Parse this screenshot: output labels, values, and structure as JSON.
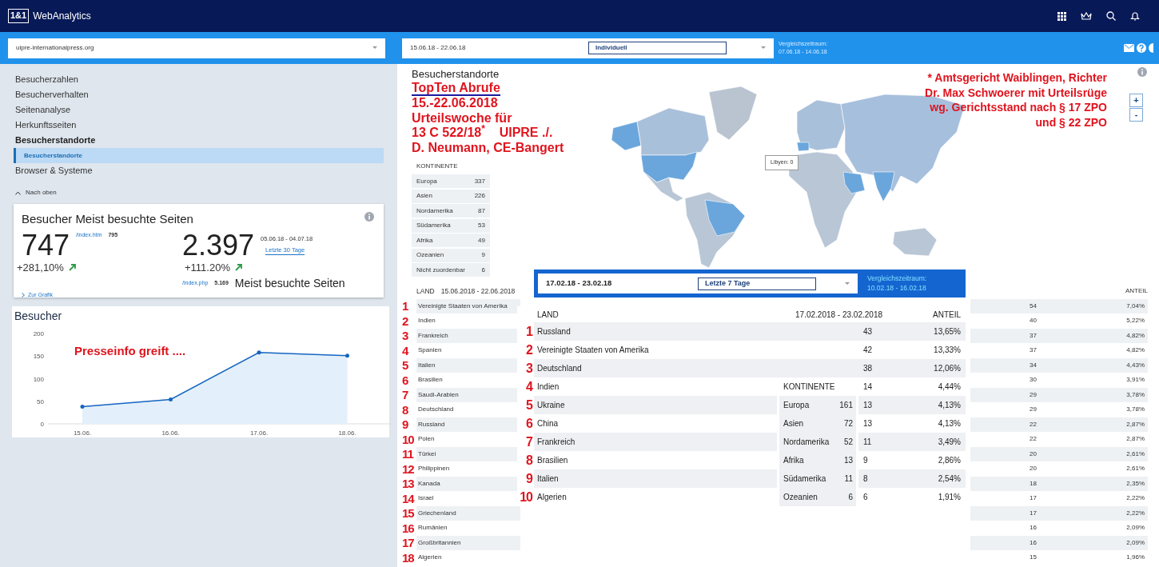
{
  "app": {
    "logo": "1&1",
    "title": "WebAnalytics"
  },
  "site_select": {
    "value": "uipre-internationalpress.org"
  },
  "date_range": {
    "value": "15.06.18 - 22.06.18",
    "preset": "Individuell",
    "comparison_label": "Vergleichszeitraum:",
    "comparison_range": "07.06.18 - 14.06.18"
  },
  "sidebar": {
    "items": [
      {
        "label": "Besucherzahlen",
        "expanded": false,
        "selected": false
      },
      {
        "label": "Besucherverhalten",
        "expanded": false,
        "selected": false
      },
      {
        "label": "Seitenanalyse",
        "expanded": false,
        "selected": false
      },
      {
        "label": "Herkunftsseiten",
        "expanded": false,
        "selected": false
      },
      {
        "label": "Besucherstandorte",
        "expanded": true,
        "selected": false,
        "children": [
          {
            "label": "Besucherstandorte",
            "selected": true
          }
        ]
      },
      {
        "label": "Browser & Systeme",
        "expanded": false,
        "selected": false
      }
    ],
    "back_to_top": "Nach oben"
  },
  "summary_card": {
    "title": "Besucher",
    "overlay_title": "Meist besuchte Seiten",
    "value": "747",
    "top_page": "/index.htm",
    "top_page_count": "795",
    "change": "+281,10%",
    "link": "Zur Grafik",
    "value_2": "2.397",
    "range_2": "05.06.18 - 04.07.18",
    "preset_2": "Letzte 30 Tage",
    "change_2": "+111.20%",
    "page_2": "/index.php",
    "page_2_count": "5.169",
    "caption_2": "Meist besuchte Seiten"
  },
  "visitors_chart": {
    "title": "Besucher",
    "annotation": "Presseinfo greift ....",
    "chart_data": {
      "type": "area",
      "categories": [
        "15.06.",
        "16.06.",
        "17.06.",
        "18.06."
      ],
      "series": [
        {
          "color": "#1565c0",
          "values": [
            38,
            54,
            158,
            151
          ]
        }
      ],
      "ylim": [
        0,
        200
      ],
      "yticks": [
        0,
        50,
        100,
        150,
        200
      ]
    }
  },
  "locations": {
    "title": "Besucherstandorte",
    "annotation": {
      "heading": "TopTen Abrufe",
      "lines": [
        "15.-22.06.2018",
        "Urteilswoche für",
        "13 C 522/18$^{*}$    UIPRE ./.",
        "D. Neumann, CE-Bangert"
      ]
    },
    "footnote": [
      "* Amtsgericht Waiblingen, Richter",
      "Dr. Max Schwoerer mit Urteilsrüge",
      "wg. Gerichtsstand nach § 17 ZPO",
      "und § 22 ZPO"
    ],
    "continents": {
      "header": "KONTINENTE",
      "rows": [
        {
          "name": "Europa",
          "value": "337"
        },
        {
          "name": "Asien",
          "value": "226"
        },
        {
          "name": "Nordamerika",
          "value": "87"
        },
        {
          "name": "Südamerika",
          "value": "53"
        },
        {
          "name": "Afrika",
          "value": "49"
        },
        {
          "name": "Ozeanien",
          "value": "9"
        },
        {
          "name": "Nicht zuordenbar",
          "value": "6"
        }
      ]
    },
    "map_tooltip": "Libyen: 0",
    "zoom_in": "+",
    "zoom_out": "-",
    "table": {
      "columns": [
        "LAND",
        "15.06.2018 - 22.06.2018",
        "ANTEIL"
      ],
      "rows": [
        {
          "rank": "1",
          "country": "Vereinigte Staaten von Amerika",
          "count": "54",
          "share": "7,04%"
        },
        {
          "rank": "2",
          "country": "Indien",
          "count": "40",
          "share": "5,22%"
        },
        {
          "rank": "3",
          "country": "Frankreich",
          "count": "37",
          "share": "4,82%"
        },
        {
          "rank": "4",
          "country": "Spanien",
          "count": "37",
          "share": "4,82%"
        },
        {
          "rank": "5",
          "country": "Italien",
          "count": "34",
          "share": "4,43%"
        },
        {
          "rank": "6",
          "country": "Brasilien",
          "count": "30",
          "share": "3,91%"
        },
        {
          "rank": "7",
          "country": "Saudi-Arabien",
          "count": "29",
          "share": "3,78%"
        },
        {
          "rank": "8",
          "country": "Deutschland",
          "count": "29",
          "share": "3,78%"
        },
        {
          "rank": "9",
          "country": "Russland",
          "count": "22",
          "share": "2,87%"
        },
        {
          "rank": "10",
          "country": "Polen",
          "count": "22",
          "share": "2,87%"
        },
        {
          "rank": "11",
          "country": "Türkei",
          "count": "20",
          "share": "2,61%"
        },
        {
          "rank": "12",
          "country": "Philippinen",
          "count": "20",
          "share": "2,61%"
        },
        {
          "rank": "13",
          "country": "Kanada",
          "count": "18",
          "share": "2,35%"
        },
        {
          "rank": "14",
          "country": "Israel",
          "count": "17",
          "share": "2,22%"
        },
        {
          "rank": "15",
          "country": "Griechenland",
          "count": "17",
          "share": "2,22%"
        },
        {
          "rank": "16",
          "country": "Rumänien",
          "count": "16",
          "share": "2,09%"
        },
        {
          "rank": "17",
          "country": "Großbritannien",
          "count": "16",
          "share": "2,09%"
        },
        {
          "rank": "18",
          "country": "Algerien",
          "count": "15",
          "share": "1,96%"
        }
      ]
    }
  },
  "comparison_overlay": {
    "date_range": "17.02.18 - 23.02.18",
    "preset": "Letzte 7 Tage",
    "comparison_label": "Vergleichszeitraum:",
    "comparison_range": "10.02.18 - 16.02.18",
    "columns": [
      "LAND",
      "17.02.2018 - 23.02.2018",
      "ANTEIL"
    ],
    "rows": [
      {
        "rank": "1",
        "country": "Russland",
        "count": "43",
        "share": "13,65%"
      },
      {
        "rank": "2",
        "country": "Vereinigte Staaten von Amerika",
        "count": "42",
        "share": "13,33%"
      },
      {
        "rank": "3",
        "country": "Deutschland",
        "count": "38",
        "share": "12,06%"
      },
      {
        "rank": "4",
        "country": "Indien",
        "count": "14",
        "share": "4,44%"
      },
      {
        "rank": "5",
        "country": "Ukraine",
        "count": "13",
        "share": "4,13%"
      },
      {
        "rank": "6",
        "country": "China",
        "count": "13",
        "share": "4,13%"
      },
      {
        "rank": "7",
        "country": "Frankreich",
        "count": "11",
        "share": "3,49%"
      },
      {
        "rank": "8",
        "country": "Brasilien",
        "count": "9",
        "share": "2,86%"
      },
      {
        "rank": "9",
        "country": "Italien",
        "count": "8",
        "share": "2,54%"
      },
      {
        "rank": "10",
        "country": "Algerien",
        "count": "6",
        "share": "1,91%"
      }
    ],
    "continents": {
      "header": "KONTINENTE",
      "rows": [
        {
          "name": "Europa",
          "value": "161"
        },
        {
          "name": "Asien",
          "value": "72"
        },
        {
          "name": "Nordamerika",
          "value": "52"
        },
        {
          "name": "Afrika",
          "value": "13"
        },
        {
          "name": "Südamerika",
          "value": "11"
        },
        {
          "name": "Ozeanien",
          "value": "6"
        }
      ]
    }
  }
}
